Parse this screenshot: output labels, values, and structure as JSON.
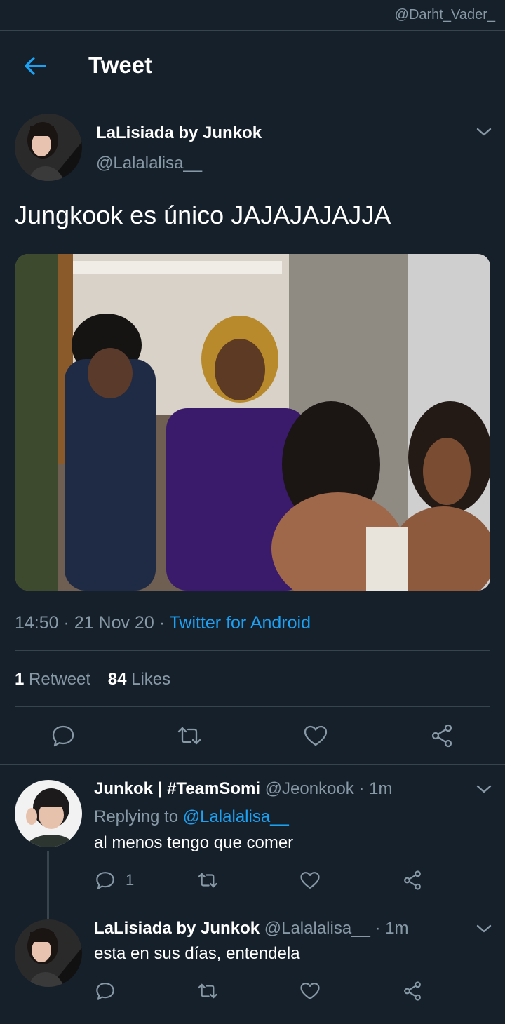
{
  "watermark": "@Darht_Vader_",
  "header": {
    "title": "Tweet"
  },
  "tweet": {
    "author_name": "LaLisiada by Junkok",
    "author_handle": "@Lalalalisa__",
    "text": "Jungkook es único JAJAJAJAJJA",
    "timestamp": "14:50 · 21 Nov 20 · ",
    "source": "Twitter for Android",
    "stats": {
      "retweets_count": "1",
      "retweets_label": "Retweet",
      "likes_count": "84",
      "likes_label": "Likes"
    },
    "actions": [
      "reply-icon",
      "retweet-icon",
      "like-icon",
      "share-icon"
    ]
  },
  "replies": [
    {
      "author_name": "Junkok | #TeamSomi",
      "author_handle": "@Jeonkook",
      "time": "· 1m",
      "replying_prefix": "Replying to ",
      "replying_handle": "@Lalalalisa__",
      "text": "al menos tengo que comer",
      "reply_count": "1"
    },
    {
      "author_name": "LaLisiada by Junkok",
      "author_handle": "@Lalalalisa__",
      "time": "· 1m",
      "text": "esta en sus días, entendela"
    }
  ],
  "colors": {
    "background": "#15202b",
    "accent": "#1da1f2",
    "muted": "#8899a6",
    "divider": "#38444d"
  }
}
